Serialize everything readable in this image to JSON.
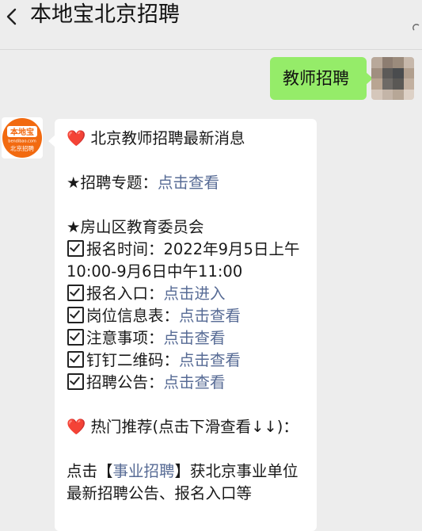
{
  "header": {
    "title": "本地宝北京招聘",
    "back_icon": "chevron-left-icon",
    "more_icon": "more-dots-icon"
  },
  "outgoing": {
    "text": "教师招聘",
    "avatar": "pixelated-avatar"
  },
  "incoming": {
    "avatar": {
      "brand": "本地宝",
      "domain": "bendibao.com",
      "caption": "北京招聘"
    },
    "heading_emoji": "❤️",
    "heading": "北京教师招聘最新消息",
    "topic_label": "★招聘专题：",
    "topic_link": "点击查看",
    "org": "★房山区教育委员会",
    "items": [
      {
        "label": "报名时间：2022年9月5日上午10:00-9月6日中午11:00",
        "link": ""
      },
      {
        "label": "报名入口：",
        "link": "点击进入"
      },
      {
        "label": "岗位信息表：",
        "link": "点击查看"
      },
      {
        "label": "注意事项：",
        "link": "点击查看"
      },
      {
        "label": "钉钉二维码：",
        "link": "点击查看"
      },
      {
        "label": "招聘公告：",
        "link": "点击查看"
      }
    ],
    "hot_emoji": "❤️",
    "hot": "热门推荐(点击下滑查看↓↓)：",
    "footer_prefix": "点击【",
    "footer_link": "事业招聘",
    "footer_suffix": "】获北京事业单位最新招聘公告、报名入口等"
  },
  "colors": {
    "background": "#ededed",
    "outgoing_bubble": "#95ec69",
    "link": "#576b95",
    "heart": "#e0102e",
    "logo_orange": "#f26a10"
  }
}
